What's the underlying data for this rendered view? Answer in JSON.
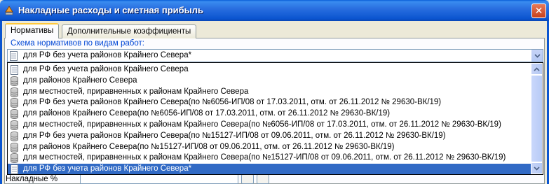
{
  "window": {
    "title": "Накладные расходы и сметная прибыль",
    "app_icon": "app-icon",
    "close_icon": "close-icon",
    "close_glyph": "✕"
  },
  "tabs": [
    {
      "label": "Нормативы",
      "active": true
    },
    {
      "label": "Дополнительные коэффициенты",
      "active": false
    }
  ],
  "norms_group": {
    "label": "Схема нормативов по видам работ:",
    "selected_value": "для РФ без учета районов Крайнего Севера*"
  },
  "dropdown": {
    "items": [
      {
        "label": "для РФ без учета районов Крайнего Севера",
        "icon": "document-icon",
        "selected": false
      },
      {
        "label": "для районов Крайнего Севера",
        "icon": "database-icon",
        "selected": false
      },
      {
        "label": "для местностей, приравненных к районам Крайнего Севера",
        "icon": "database-icon",
        "selected": false
      },
      {
        "label": "для РФ без учета районов Крайнего Севера(по №6056-ИП/08 от 17.03.2011, отм. от 26.11.2012 № 29630-ВК/19)",
        "icon": "database-icon",
        "selected": false
      },
      {
        "label": "для районов Крайнего Севера(по №6056-ИП/08 от 17.03.2011, отм. от 26.11.2012 № 29630-ВК/19)",
        "icon": "database-icon",
        "selected": false
      },
      {
        "label": "для местностей, приравненных к районам Крайнего Севера(по №6056-ИП/08 от 17.03.2011, отм. от 26.11.2012 № 29630-ВК/19)",
        "icon": "database-icon",
        "selected": false
      },
      {
        "label": "для РФ без учета районов Крайнего Севера(по №15127-ИП/08 от 09.06.2011, отм. от 26.11.2012 № 29630-ВК/19)",
        "icon": "database-icon",
        "selected": false
      },
      {
        "label": "для районов Крайнего Севера(по №15127-ИП/08 от 09.06.2011, отм. от 26.11.2012 № 29630-ВК/19)",
        "icon": "database-icon",
        "selected": false
      },
      {
        "label": "для местностей, приравненных к районам Крайнего Севера(по №15127-ИП/08 от 09.06.2011, отм. от 26.11.2012 № 29630-ВК/19)",
        "icon": "database-icon",
        "selected": false
      },
      {
        "label": "для РФ без учета районов Крайнего Севера*",
        "icon": "document-icon",
        "selected": true
      }
    ]
  },
  "bottom_row": {
    "label": "Накладные %"
  },
  "colors": {
    "titlebar": "#0b55d0",
    "selection": "#316ac5",
    "group_label": "#0046d5",
    "window_face": "#ece9d8"
  }
}
